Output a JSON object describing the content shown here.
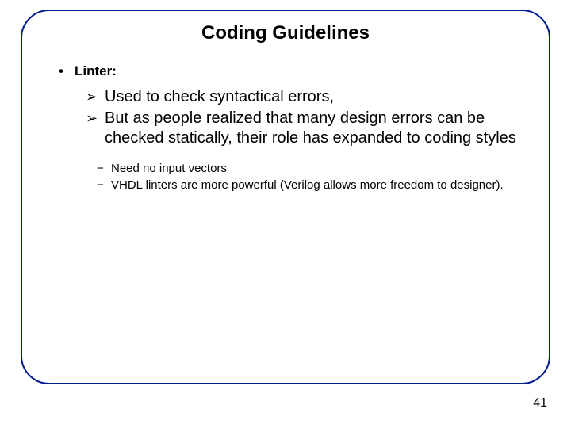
{
  "title": "Coding Guidelines",
  "lvl1": {
    "label": "Linter:"
  },
  "lvl2": {
    "items": [
      "Used to check syntactical errors,",
      "But as people realized that many design errors can be checked statically, their role has expanded to coding styles"
    ]
  },
  "lvl3": {
    "items": [
      "Need no input vectors",
      "VHDL linters are more powerful (Verilog allows more freedom to designer)."
    ]
  },
  "pagenum": "41"
}
